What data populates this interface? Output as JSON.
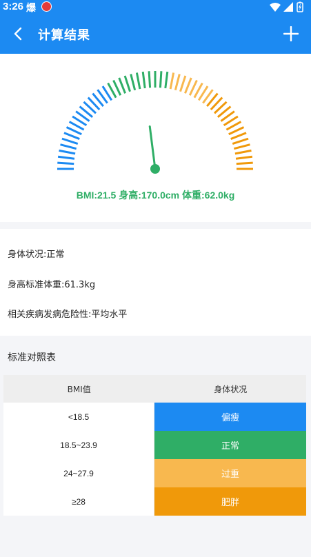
{
  "status": {
    "time": "3:26",
    "label": "爆"
  },
  "header": {
    "title": "计算结果"
  },
  "gauge": {
    "bmi_min": 10,
    "bmi_max": 35,
    "bmi_value": 21.5,
    "summary": "BMI:21.5  身高:170.0cm  体重:62.0kg"
  },
  "info": {
    "status": "身体状况:正常",
    "standard_weight": "身高标准体重:61.3kg",
    "risk": "相关疾病发病危险性:平均水平"
  },
  "table": {
    "title": "标准对照表",
    "headers": [
      "BMI值",
      "身体状况"
    ],
    "rows": [
      {
        "range": "<18.5",
        "status": "偏瘦",
        "color": "#1c8af2"
      },
      {
        "range": "18.5~23.9",
        "status": "正常",
        "color": "#2fae66"
      },
      {
        "range": "24~27.9",
        "status": "过重",
        "color": "#f8b84f"
      },
      {
        "range": "≥28",
        "status": "肥胖",
        "color": "#f0990a"
      }
    ]
  },
  "colors": {
    "primary": "#1c8af2",
    "normal": "#2fae66",
    "overweight": "#f8b84f",
    "obese": "#f0990a"
  }
}
